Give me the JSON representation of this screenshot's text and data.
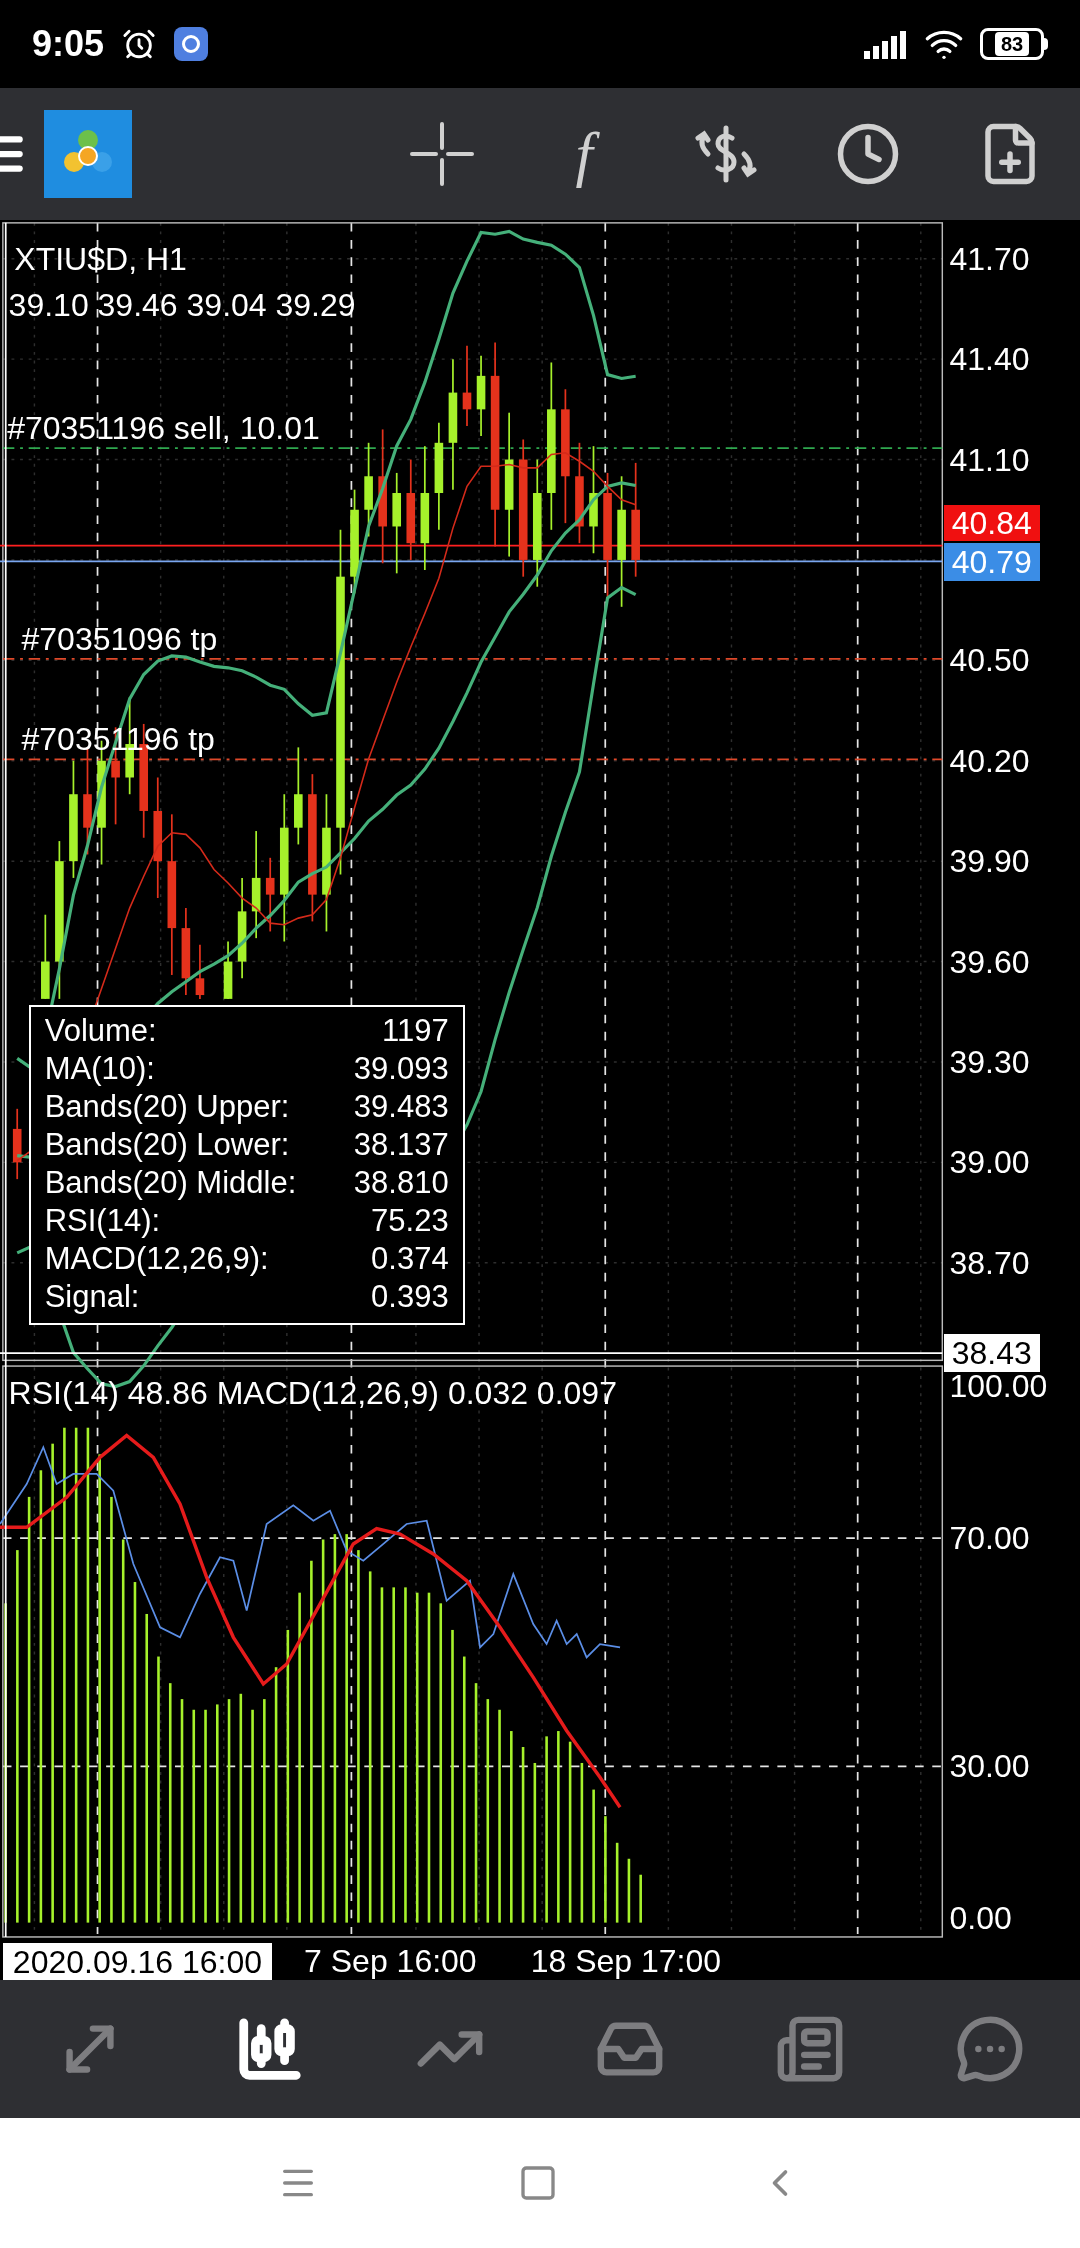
{
  "status_bar": {
    "time": "9:05",
    "battery": "83"
  },
  "toolbar": {
    "function_glyph": "f"
  },
  "chart": {
    "symbol": "XTIU$D, H1",
    "ohlc": "39.10 39.46 39.04 39.29",
    "orders": [
      {
        "label": "#70351196 sell, 10.01",
        "kind": "entry"
      },
      {
        "label": "#70351096 tp",
        "kind": "tp"
      },
      {
        "label": "#70351196 tp",
        "kind": "tp"
      }
    ],
    "price_axis": [
      "41.70",
      "41.40",
      "41.10",
      "40.50",
      "40.20",
      "39.90",
      "39.60",
      "39.30",
      "39.00",
      "38.70"
    ],
    "bid_tag": "40.84",
    "ask_tag": "40.79",
    "crosshair_price": "38.43",
    "data_window": [
      {
        "label": "Volume:",
        "value": "1197"
      },
      {
        "label": "MA(10):",
        "value": "39.093"
      },
      {
        "label": "Bands(20) Upper:",
        "value": "39.483"
      },
      {
        "label": "Bands(20) Lower:",
        "value": "38.137"
      },
      {
        "label": "Bands(20) Middle:",
        "value": "38.810"
      },
      {
        "label": "RSI(14):",
        "value": "75.23"
      },
      {
        "label": "MACD(12,26,9):",
        "value": "0.374"
      },
      {
        "label": "Signal:",
        "value": "0.393"
      }
    ]
  },
  "indicator": {
    "header": "RSI(14) 48.86 MACD(12,26,9) 0.032 0.097",
    "axis": [
      "100.00",
      "70.00",
      "30.00",
      "0.00"
    ]
  },
  "time_axis": {
    "crosshair_time": "2020.09.16 16:00",
    "labels": [
      "7 Sep 16:00",
      "18 Sep 17:00"
    ]
  },
  "bottom_tabs": [
    {
      "selected": false
    },
    {
      "selected": true
    },
    {
      "selected": false
    },
    {
      "selected": false
    },
    {
      "selected": false
    },
    {
      "selected": false
    }
  ]
}
